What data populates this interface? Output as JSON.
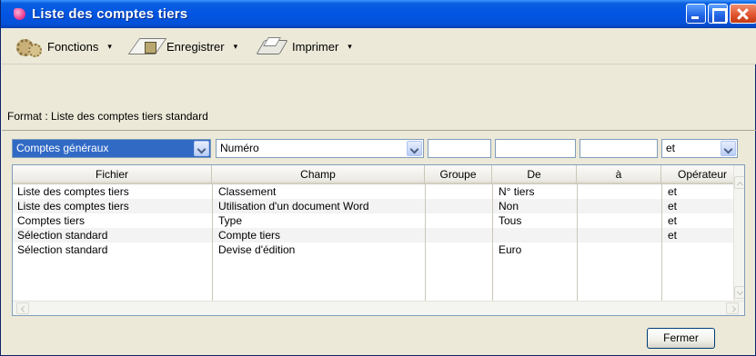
{
  "window": {
    "title": "Liste des comptes tiers",
    "controls": {
      "minimize": "minimize",
      "maximize": "maximize",
      "close": "close"
    }
  },
  "toolbar": {
    "fonctions_label": "Fonctions",
    "enregistrer_label": "Enregistrer",
    "imprimer_label": "Imprimer",
    "caret": "▾"
  },
  "format_text": "Format : Liste des comptes tiers standard",
  "filters": {
    "fichier_value": "Comptes généraux",
    "champ_value": "Numéro",
    "groupe_value": "",
    "de_value": "",
    "a_value": "",
    "operateur_value": "et"
  },
  "grid": {
    "columns": [
      "Fichier",
      "Champ",
      "Groupe",
      "De",
      "à",
      "Opérateur"
    ],
    "rows": [
      [
        "Liste des comptes tiers",
        "Classement",
        "",
        "N° tiers",
        "",
        "et"
      ],
      [
        "Liste des comptes tiers",
        "Utilisation d'un document Word",
        "",
        "Non",
        "",
        "et"
      ],
      [
        "Comptes tiers",
        "Type",
        "",
        "Tous",
        "",
        "et"
      ],
      [
        "Sélection standard",
        "Compte tiers",
        "",
        "",
        "",
        "et"
      ],
      [
        "Sélection standard",
        "Devise d'édition",
        "",
        "Euro",
        "",
        ""
      ]
    ]
  },
  "buttons": {
    "close_label": "Fermer"
  },
  "colors": {
    "titlebar": "#0254e2",
    "selection": "#316ac5",
    "window_bg": "#ece9d8"
  }
}
